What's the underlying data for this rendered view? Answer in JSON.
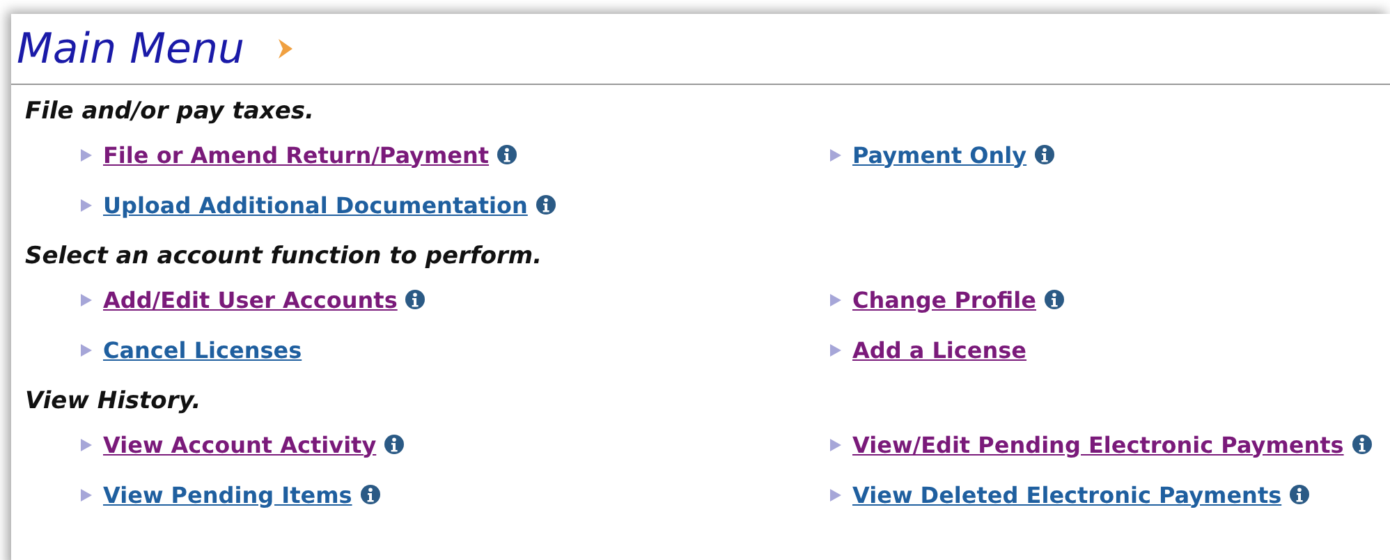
{
  "title": "Main Menu",
  "sections": [
    {
      "heading": "File and/or pay taxes.",
      "columns": [
        [
          {
            "label": "File or Amend Return/Payment",
            "visited": true,
            "info": true
          },
          {
            "label": "Upload Additional Documentation",
            "visited": false,
            "info": true
          }
        ],
        [
          {
            "label": "Payment Only",
            "visited": false,
            "info": true
          }
        ]
      ]
    },
    {
      "heading": "Select an account function to perform.",
      "columns": [
        [
          {
            "label": "Add/Edit User Accounts",
            "visited": true,
            "info": true
          },
          {
            "label": "Cancel Licenses",
            "visited": false,
            "info": false
          }
        ],
        [
          {
            "label": "Change Profile",
            "visited": true,
            "info": true
          },
          {
            "label": "Add a License",
            "visited": true,
            "info": false
          }
        ]
      ]
    },
    {
      "heading": "View History.",
      "columns": [
        [
          {
            "label": "View Account Activity",
            "visited": true,
            "info": true
          },
          {
            "label": "View Pending Items",
            "visited": false,
            "info": true
          }
        ],
        [
          {
            "label": "View/Edit Pending Electronic Payments",
            "visited": true,
            "info": true
          },
          {
            "label": "View Deleted Electronic Payments",
            "visited": false,
            "info": true
          }
        ]
      ]
    }
  ]
}
